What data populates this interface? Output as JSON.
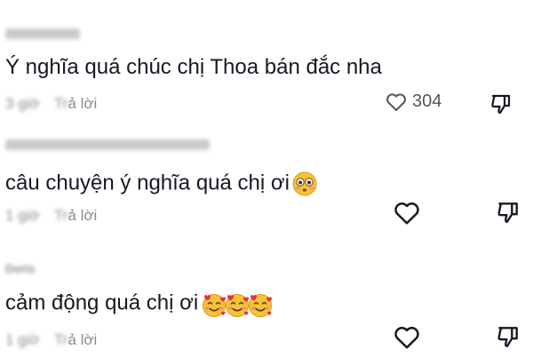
{
  "comments": [
    {
      "username": "",
      "text": "Ý nghĩa quá chúc chị Thoa bán đắc nha",
      "time": "3 giờ",
      "reply_prefix": "Tr",
      "reply_rest": "ả lời",
      "like_count": "304",
      "emoji": []
    },
    {
      "username": "",
      "text": "câu chuyện ý nghĩa quá chị ơi",
      "time": "1 giờ",
      "reply_prefix": "Tr",
      "reply_rest": "ả lời",
      "like_count": "",
      "emoji": [
        "flushed-face"
      ]
    },
    {
      "username": "Doris",
      "text": "cảm động quá chị ơi",
      "time": "1 giờ",
      "reply_prefix": "Tr",
      "reply_rest": "ả lời",
      "like_count": "",
      "emoji": [
        "smiling-face-with-hearts",
        "smiling-face-with-hearts",
        "smiling-face-with-hearts"
      ]
    }
  ],
  "icons": {
    "like": "heart-outline-icon",
    "dislike": "thumbs-down-icon"
  },
  "colors": {
    "text": "#161823",
    "muted": "#8a8b91",
    "emoji_face": "#f7c23a"
  }
}
